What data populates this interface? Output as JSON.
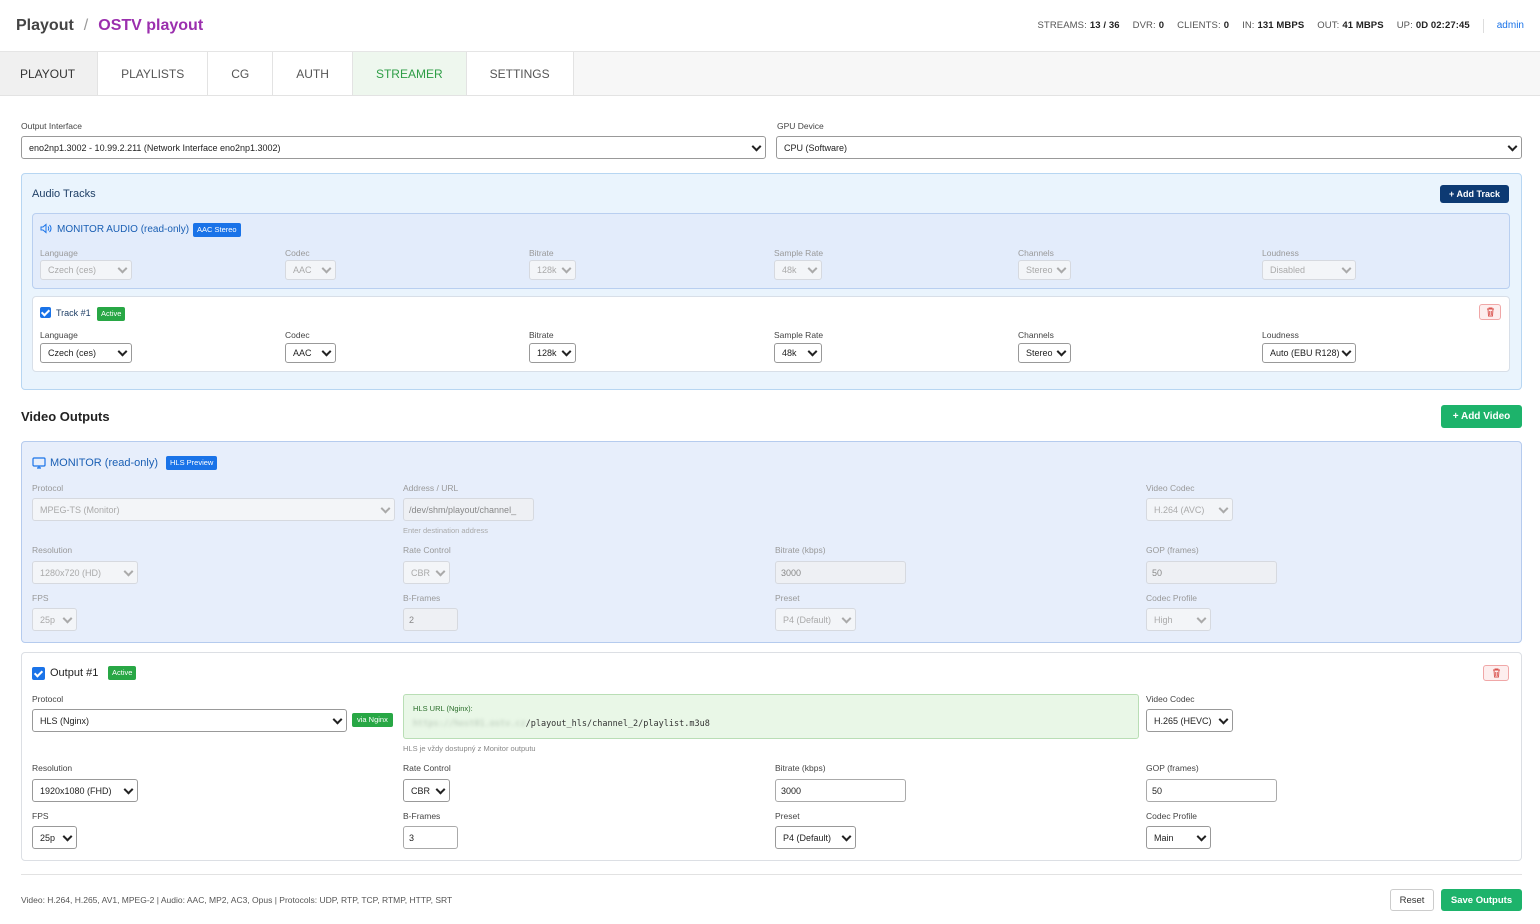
{
  "header": {
    "breadcrumb_root": "Playout",
    "breadcrumb_sep": "/",
    "channel": "OSTV playout",
    "stats": [
      {
        "label": "STREAMS:",
        "value": "13 / 36"
      },
      {
        "label": "DVR:",
        "value": "0"
      },
      {
        "label": "CLIENTS:",
        "value": "0"
      },
      {
        "label": "IN:",
        "value": "131 MBPS"
      },
      {
        "label": "OUT:",
        "value": "41 MBPS"
      },
      {
        "label": "UP:",
        "value": "0D 02:27:45"
      }
    ],
    "user": "admin"
  },
  "tabs": [
    "PLAYOUT",
    "PLAYLISTS",
    "CG",
    "AUTH",
    "STREAMER",
    "SETTINGS"
  ],
  "active_tab": "STREAMER",
  "output_interface": {
    "label": "Output Interface",
    "value": "eno2np1.3002 - 10.99.2.211 (Network Interface eno2np1.3002)"
  },
  "gpu_device": {
    "label": "GPU Device",
    "value": "CPU (Software)"
  },
  "audio": {
    "title": "Audio Tracks",
    "add_button": "+ Add Track",
    "field_labels": [
      "Language",
      "Codec",
      "Bitrate",
      "Sample Rate",
      "Channels",
      "Loudness"
    ],
    "monitor": {
      "title": "MONITOR AUDIO (read-only)",
      "badge": "AAC Stereo",
      "values": [
        "Czech (ces)",
        "AAC",
        "128k",
        "48k",
        "Stereo",
        "Disabled"
      ]
    },
    "track1": {
      "title": "Track #1",
      "badge": "Active",
      "values": [
        "Czech (ces)",
        "AAC",
        "128k",
        "48k",
        "Stereo",
        "Auto (EBU R128)"
      ]
    }
  },
  "video": {
    "title": "Video Outputs",
    "add_button": "+ Add Video",
    "monitor": {
      "title": "MONITOR (read-only)",
      "badge": "HLS Preview",
      "protocol_label": "Protocol",
      "protocol": "MPEG-TS (Monitor)",
      "address_label": "Address / URL",
      "address": "/dev/shm/playout/channel_",
      "address_hint": "Enter destination address",
      "codec_label": "Video Codec",
      "codec": "H.264 (AVC)",
      "resolution_label": "Resolution",
      "resolution": "1280x720 (HD)",
      "rate_label": "Rate Control",
      "rate": "CBR",
      "bitrate_label": "Bitrate (kbps)",
      "bitrate": "3000",
      "gop_label": "GOP (frames)",
      "gop": "50",
      "fps_label": "FPS",
      "fps": "25p",
      "bframes_label": "B-Frames",
      "bframes": "2",
      "preset_label": "Preset",
      "preset": "P4 (Default)",
      "profile_label": "Codec Profile",
      "profile": "High"
    },
    "output1": {
      "title": "Output #1",
      "badge": "Active",
      "protocol_label": "Protocol",
      "protocol": "HLS (Nginx)",
      "via_badge": "via Nginx",
      "hls_label": "HLS URL (Nginx):",
      "hls_host": "https://host01.ostv.cz",
      "hls_path": "/playout_hls/channel_2/playlist.m3u8",
      "hls_hint": "HLS je vždy dostupný z Monitor outputu",
      "codec_label": "Video Codec",
      "codec": "H.265 (HEVC)",
      "resolution_label": "Resolution",
      "resolution": "1920x1080 (FHD)",
      "rate_label": "Rate Control",
      "rate": "CBR",
      "bitrate_label": "Bitrate (kbps)",
      "bitrate": "3000",
      "gop_label": "GOP (frames)",
      "gop": "50",
      "fps_label": "FPS",
      "fps": "25p",
      "bframes_label": "B-Frames",
      "bframes": "3",
      "preset_label": "Preset",
      "preset": "P4 (Default)",
      "profile_label": "Codec Profile",
      "profile": "Main"
    }
  },
  "footer": {
    "info": "Video: H.264, H.265, AV1, MPEG-2 | Audio: AAC, MP2, AC3, Opus | Protocols: UDP, RTP, TCP, RTMP, HTTP, SRT",
    "reset": "Reset",
    "save": "Save Outputs"
  },
  "colors": {
    "accent": "#1a73e8",
    "channel": "#9b2fae",
    "green": "#1db36b",
    "navy": "#0d3a73"
  }
}
